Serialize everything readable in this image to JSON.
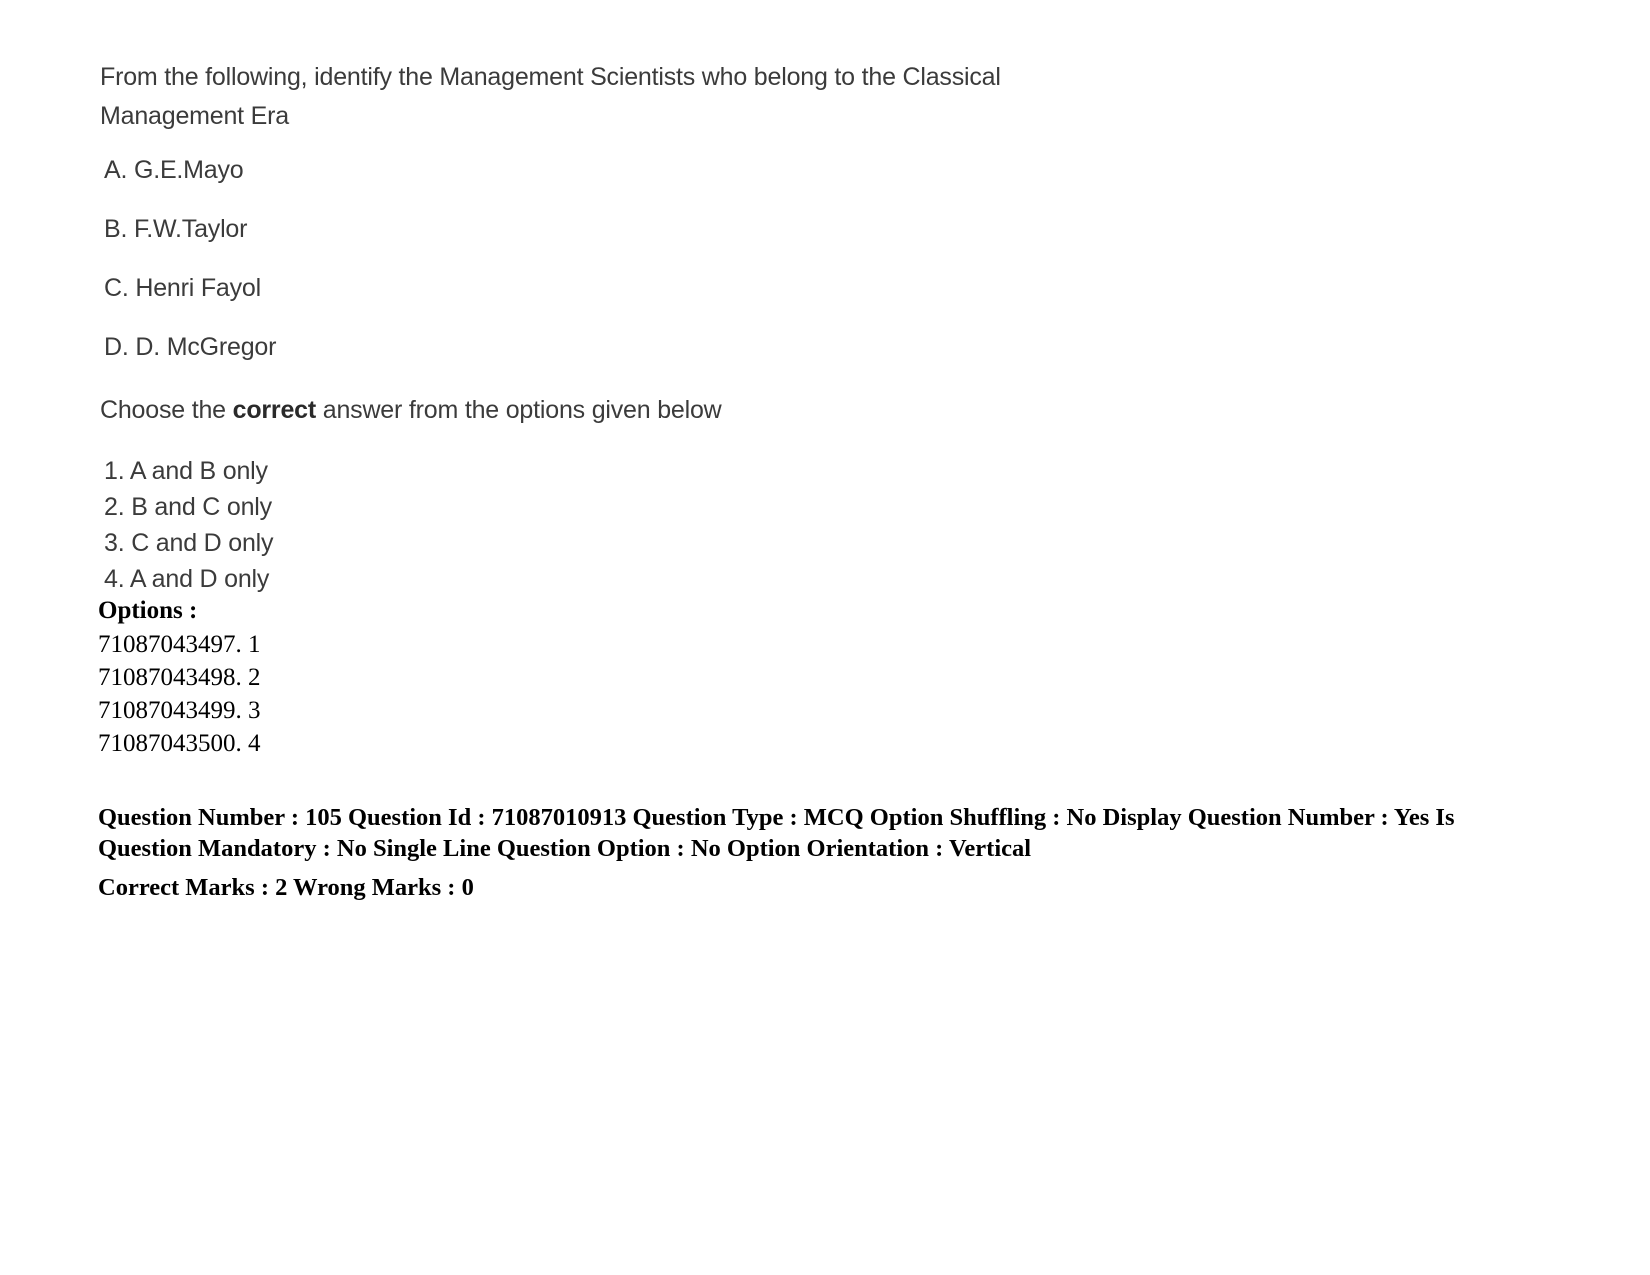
{
  "question": {
    "stem": "From the following, identify the Management Scientists who belong to the Classical Management Era",
    "statements": [
      "A. G.E.Mayo",
      "B. F.W.Taylor",
      "C. Henri Fayol",
      "D. D. McGregor"
    ],
    "choose_prefix": "Choose the ",
    "choose_bold": "correct",
    "choose_suffix": " answer from the options given below",
    "answers": [
      "1. A and B only",
      "2. B and C only",
      "3. C and D only",
      "4. A and D only"
    ]
  },
  "options": {
    "header": "Options :",
    "rows": [
      "71087043497. 1",
      "71087043498. 2",
      "71087043499. 3",
      "71087043500. 4"
    ]
  },
  "meta": {
    "line1": "Question Number : 105 Question Id : 71087010913 Question Type : MCQ Option Shuffling : No Display Question Number : Yes Is",
    "line2": "Question Mandatory : No Single Line Question Option : No Option Orientation : Vertical",
    "line3": "Correct Marks : 2 Wrong Marks : 0",
    "question_number": "105",
    "question_id": "71087010913",
    "question_type": "MCQ",
    "option_shuffling": "No",
    "display_question_number": "Yes",
    "is_question_mandatory": "No",
    "single_line_question_option": "No",
    "option_orientation": "Vertical",
    "correct_marks": "2",
    "wrong_marks": "0"
  },
  "colors": {
    "page_background": "#ffffff",
    "scan_ink": "#3b3b3b",
    "meta_ink": "#000000"
  }
}
